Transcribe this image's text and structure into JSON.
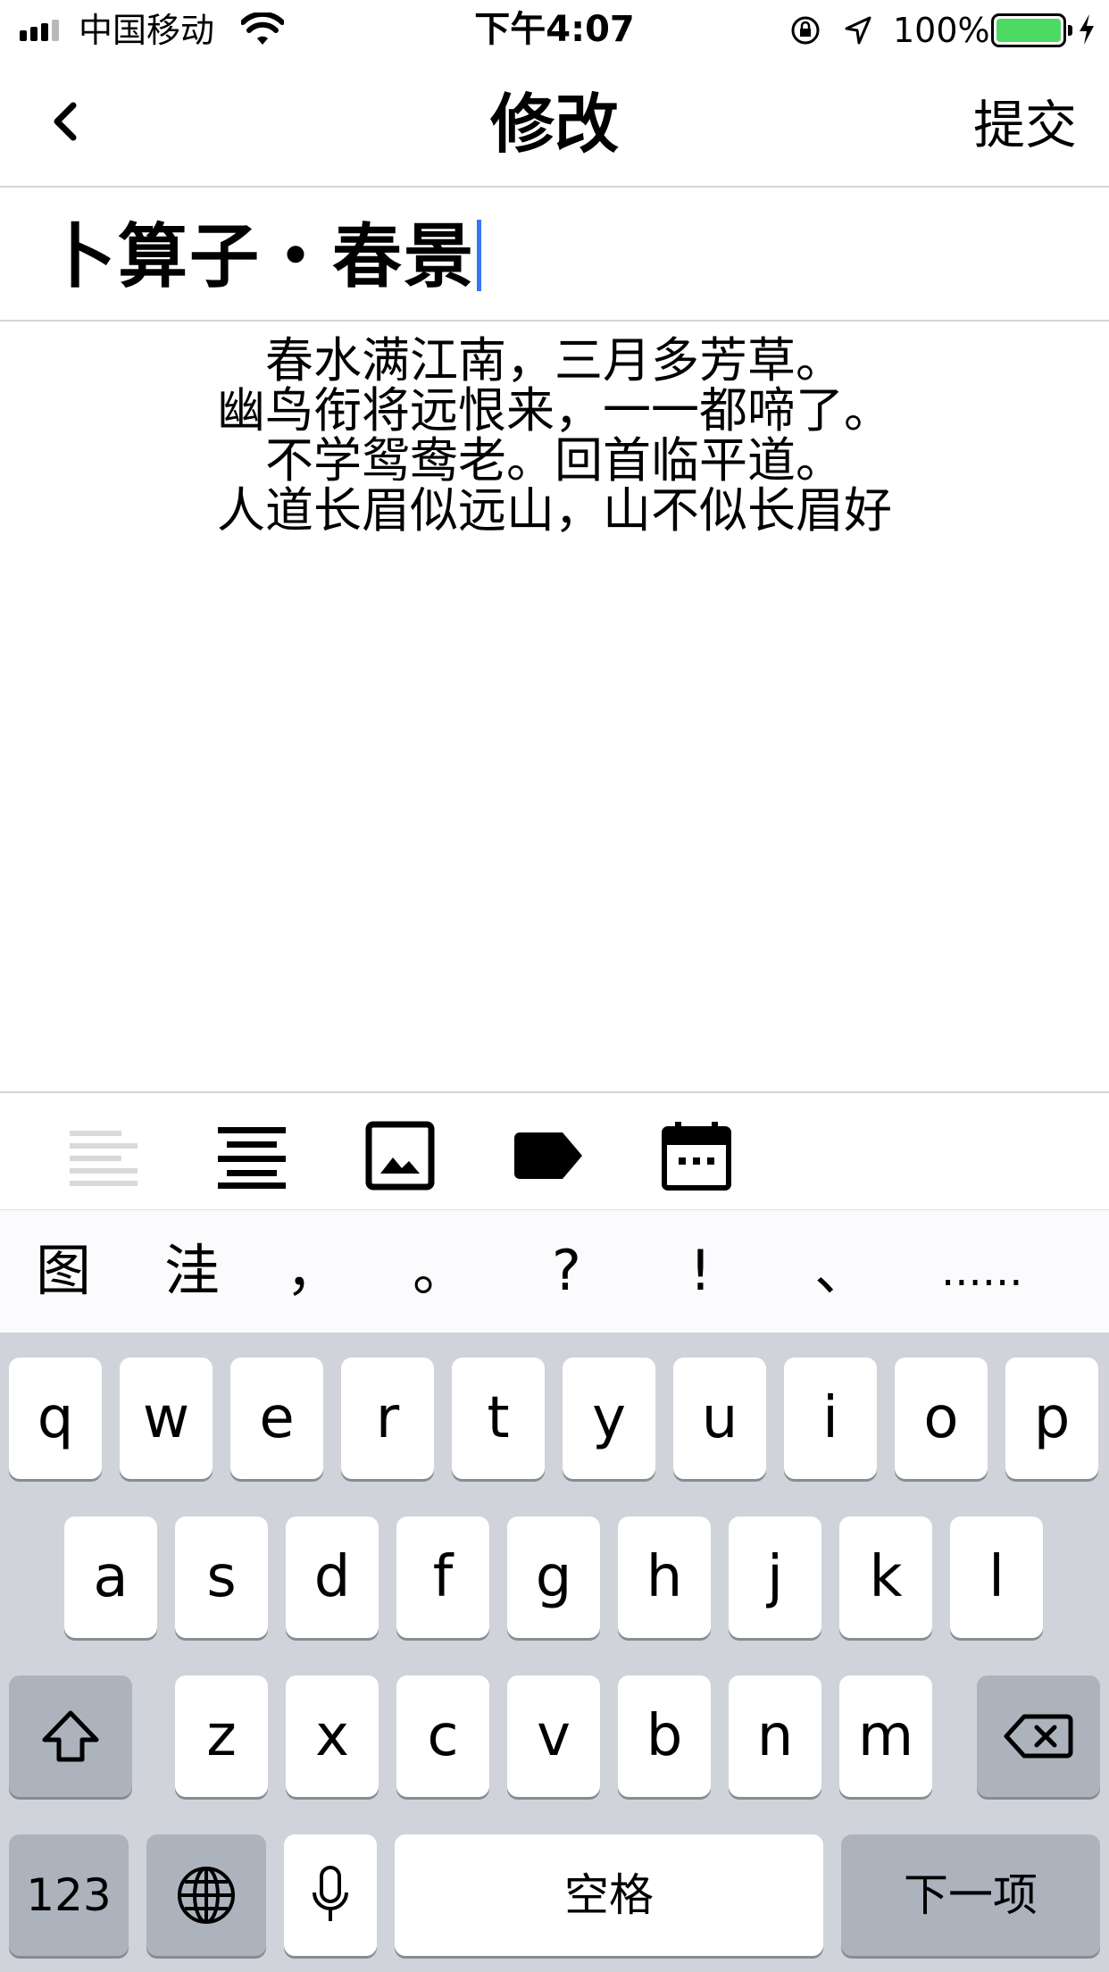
{
  "status_bar": {
    "carrier": "中国移动",
    "time": "下午4:07",
    "battery_percent": "100%",
    "battery_level": 1.0,
    "battery_color": "#4cd964",
    "icons": [
      "signal-icon",
      "wifi-icon",
      "orientation-lock-icon",
      "location-icon",
      "battery-icon",
      "charging-icon"
    ]
  },
  "nav": {
    "back_icon": "chevron-left-icon",
    "title": "修改",
    "submit_label": "提交"
  },
  "title_field": {
    "value": "卜算子・春景",
    "caret_color": "#3478f6"
  },
  "body": {
    "lines": [
      "春水满江南，三月多芳草。",
      "幽鸟衔将远恨来，一一都啼了。",
      "不学鸳鸯老。回首临平道。",
      "人道长眉似远山，山不似长眉好"
    ]
  },
  "toolbar": {
    "buttons": [
      {
        "icon": "align-left-icon",
        "state": "disabled"
      },
      {
        "icon": "align-center-icon",
        "state": "active"
      },
      {
        "icon": "image-icon",
        "state": "active"
      },
      {
        "icon": "tag-icon",
        "state": "active"
      },
      {
        "icon": "calendar-icon",
        "state": "active"
      }
    ]
  },
  "candidates": [
    "图",
    "洼",
    "，",
    "。",
    "?",
    "!",
    "、",
    "......"
  ],
  "keyboard": {
    "row1": [
      "q",
      "w",
      "e",
      "r",
      "t",
      "y",
      "u",
      "i",
      "o",
      "p"
    ],
    "row2": [
      "a",
      "s",
      "d",
      "f",
      "g",
      "h",
      "j",
      "k",
      "l"
    ],
    "row3": [
      "z",
      "x",
      "c",
      "v",
      "b",
      "n",
      "m"
    ],
    "shift_icon": "shift-icon",
    "delete_icon": "delete-icon",
    "numbers_label": "123",
    "globe_icon": "globe-icon",
    "mic_icon": "microphone-icon",
    "space_label": "空格",
    "next_label": "下一项"
  }
}
